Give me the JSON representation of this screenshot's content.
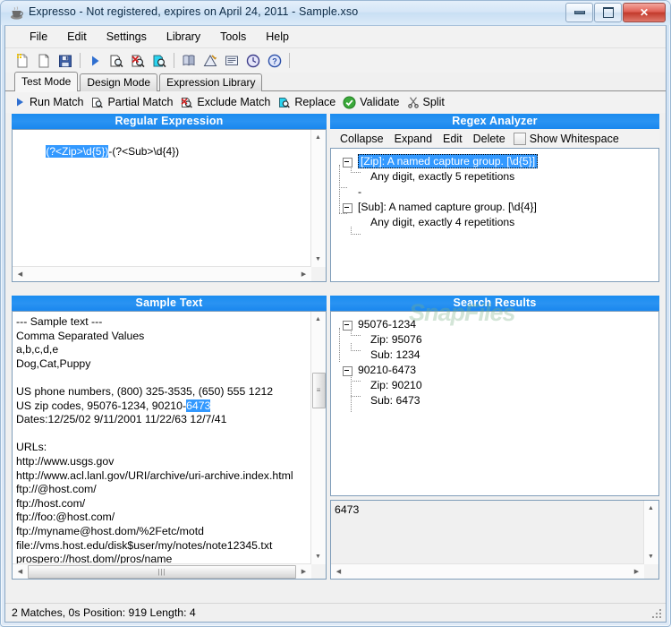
{
  "window": {
    "title": "Expresso - Not registered, expires on April 24, 2011 - Sample.xso",
    "icon": "expresso-app-icon",
    "controls": {
      "minimize": "minimize-button",
      "maximize": "maximize-button",
      "close_label": "✕"
    }
  },
  "menu": {
    "items": [
      {
        "label": "File"
      },
      {
        "label": "Edit"
      },
      {
        "label": "Settings"
      },
      {
        "label": "Library"
      },
      {
        "label": "Tools"
      },
      {
        "label": "Help"
      }
    ]
  },
  "toolbar": {
    "buttons": [
      {
        "name": "new-document-icon"
      },
      {
        "name": "open-document-icon"
      },
      {
        "name": "save-icon"
      },
      {
        "name": "run-match-icon"
      },
      {
        "name": "partial-match-icon"
      },
      {
        "name": "exclude-match-icon"
      },
      {
        "name": "replace-icon"
      },
      {
        "name": "library-book-icon"
      },
      {
        "name": "design-ruler-icon"
      },
      {
        "name": "report-icon"
      },
      {
        "name": "history-clock-icon"
      },
      {
        "name": "help-icon"
      }
    ]
  },
  "tabs": [
    {
      "label": "Test Mode",
      "active": true
    },
    {
      "label": "Design Mode",
      "active": false
    },
    {
      "label": "Expression Library",
      "active": false
    }
  ],
  "actions": [
    {
      "label": "Run Match",
      "icon": "play-triangle-icon"
    },
    {
      "label": "Partial Match",
      "icon": "partial-match-icon"
    },
    {
      "label": "Exclude Match",
      "icon": "exclude-match-icon"
    },
    {
      "label": "Replace",
      "icon": "replace-icon"
    },
    {
      "label": "Validate",
      "icon": "validate-check-icon"
    },
    {
      "label": "Split",
      "icon": "split-scissors-icon"
    }
  ],
  "regex_panel": {
    "title": "Regular Expression",
    "value_highlighted": "(?<Zip>\\d{5})",
    "value_rest": "-(?<Sub>\\d{4})"
  },
  "analyzer_panel": {
    "title": "Regex Analyzer",
    "toolbar": [
      {
        "label": "Collapse"
      },
      {
        "label": "Expand"
      },
      {
        "label": "Edit"
      },
      {
        "label": "Delete"
      }
    ],
    "checkbox_label": "Show Whitespace",
    "checkbox_checked": false,
    "tree": [
      {
        "label": "[Zip]: A named capture group. [\\d{5}]",
        "level": 0,
        "expander": true,
        "selected": true
      },
      {
        "label": "Any digit, exactly 5 repetitions",
        "level": 1,
        "expander": false,
        "selected": false
      },
      {
        "label": "-",
        "level": 1,
        "expander": false,
        "selected": false
      },
      {
        "label": "[Sub]: A named capture group. [\\d{4}]",
        "level": 0,
        "expander": true,
        "selected": false
      },
      {
        "label": "Any digit, exactly 4 repetitions",
        "level": 1,
        "expander": false,
        "selected": false
      }
    ]
  },
  "sample_panel": {
    "title": "Sample Text",
    "lines_before": "--- Sample text ---\nComma Separated Values\na,b,c,d,e\nDog,Cat,Puppy\n\nUS phone numbers, (800) 325-3535, (650) 555 1212\nUS zip codes, 95076-1234, 90210-",
    "selection": "6473",
    "lines_after": "\nDates:12/25/02 9/11/2001 11/22/63 12/7/41\n\nURLs:\nhttp://www.usgs.gov\nhttp://www.acl.lanl.gov/URI/archive/uri-archive.index.html\nftp://@host.com/\nftp://host.com/\nftp://foo:@host.com/\nftp://myname@host.dom/%2Fetc/motd\nfile://vms.host.edu/disk$user/my/notes/note12345.txt\nprospero://host.dom//pros/name"
  },
  "results_panel": {
    "title": "Search Results",
    "watermark": "SnapFiles",
    "tree": [
      {
        "label": "95076-1234",
        "level": 0,
        "expander": true
      },
      {
        "label": "Zip: 95076",
        "level": 1,
        "expander": false
      },
      {
        "label": "Sub: 1234",
        "level": 1,
        "expander": false
      },
      {
        "label": "90210-6473",
        "level": 0,
        "expander": true
      },
      {
        "label": "Zip: 90210",
        "level": 1,
        "expander": false
      },
      {
        "label": "Sub: 6473",
        "level": 1,
        "expander": false
      }
    ],
    "detail_value": "6473"
  },
  "statusbar": {
    "text": "2 Matches, 0s  Position: 919  Length: 4"
  },
  "colors": {
    "panel_header_blue": "#1f8cf0",
    "selection_blue": "#3399ff",
    "window_chrome": "#d3e4f5",
    "close_red": "#c23a2c"
  }
}
